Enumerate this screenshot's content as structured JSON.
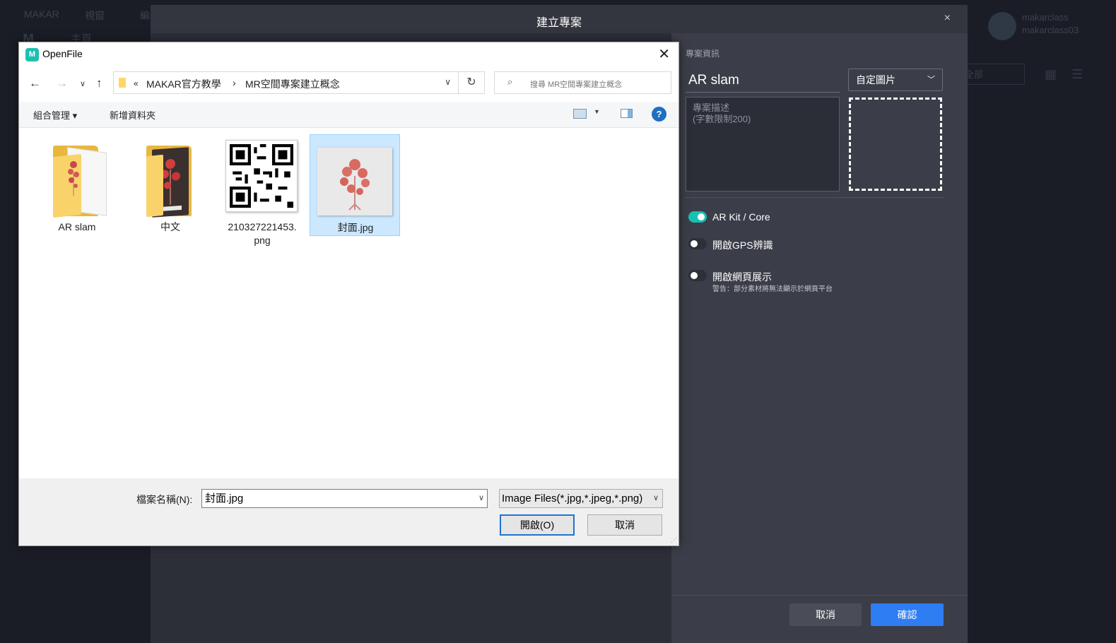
{
  "background": {
    "nav": [
      "MAKAR",
      "視窗",
      "編"
    ],
    "home": "主頁",
    "user": {
      "name": "makarclass",
      "id": "makarclass03"
    },
    "filter": "全部"
  },
  "modal": {
    "title": "建立專案",
    "close": "×",
    "section_label": "專案資訊",
    "project_name": "AR slam",
    "image_select": "自定圖片",
    "description_placeholder": "專案描述\n(字數限制200)",
    "toggles": [
      {
        "label": "AR Kit / Core",
        "on": true
      },
      {
        "label": "開啟GPS辨識",
        "on": false
      },
      {
        "label": "開啟網頁展示",
        "on": false
      }
    ],
    "warning": "警告：部分素材將無法顯示於網頁平台",
    "cancel": "取消",
    "confirm": "確認",
    "colors": {
      "accent": "#2e7df3",
      "toggle_on": "#17c0b0"
    }
  },
  "dialog": {
    "title": "OpenFile",
    "app_icon": "M",
    "close": "✕",
    "breadcrumb": [
      "«",
      "MAKAR官方教學",
      "›",
      "MR空間專案建立概念"
    ],
    "search_placeholder": "搜尋 MR空間專案建立概念",
    "toolbar": {
      "organize": "組合管理 ▾",
      "new_folder": "新增資料夾",
      "help": "?"
    },
    "files": [
      {
        "name": "AR slam",
        "kind": "folder",
        "selected": false
      },
      {
        "name": "中文",
        "kind": "folder",
        "selected": false
      },
      {
        "name": "210327221453.\npng",
        "kind": "qr-image",
        "selected": false
      },
      {
        "name": "封面.jpg",
        "kind": "photo",
        "selected": true
      }
    ],
    "filename_label": "檔案名稱(N):",
    "filename_value": "封面.jpg",
    "filter_value": "Image Files(*.jpg,*.jpeg,*.png)",
    "open": "開啟(O)",
    "cancel": "取消"
  }
}
